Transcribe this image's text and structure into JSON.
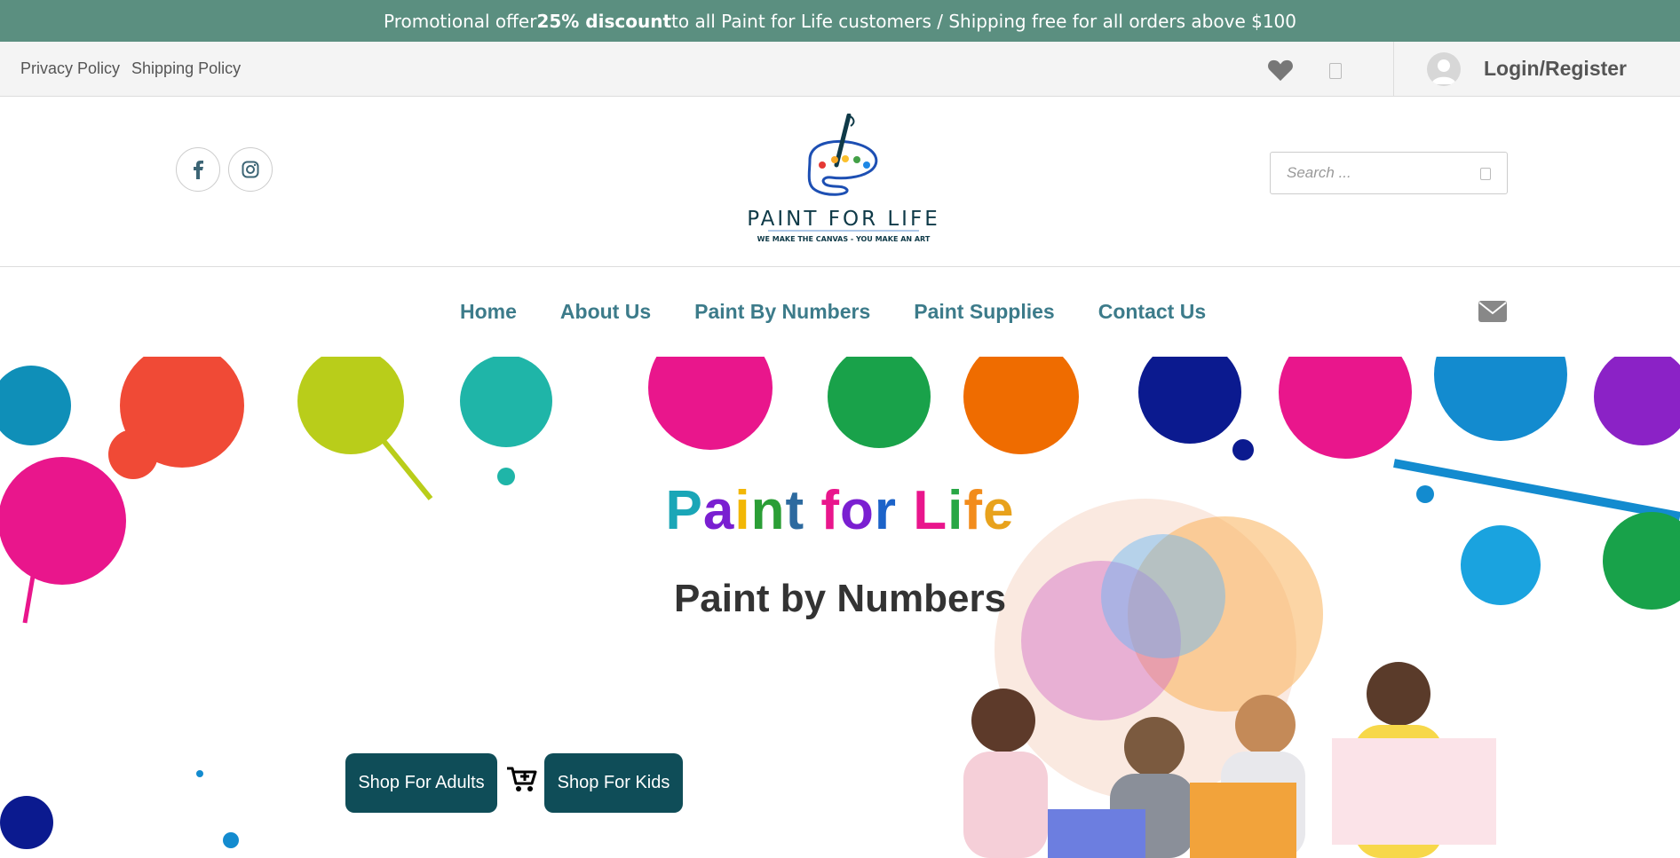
{
  "promo": {
    "prefix": "Promotional offer ",
    "highlight": "25% discount",
    "suffix": " to all Paint for Life customers / Shipping free for all orders above $100"
  },
  "topbar": {
    "links": [
      "Privacy Policy",
      "Shipping Policy"
    ],
    "login_label": "Login/Register"
  },
  "header": {
    "logo_name": "PAINT FOR LIFE",
    "logo_tagline": "WE MAKE THE CANVAS - YOU MAKE AN ART",
    "search_placeholder": "Search ..."
  },
  "nav": {
    "items": [
      "Home",
      "About Us",
      "Paint By Numbers",
      "Paint Supplies",
      "Contact Us"
    ]
  },
  "hero": {
    "title_letters": [
      "P",
      "a",
      "i",
      "n",
      "t",
      " ",
      "f",
      "o",
      "r",
      " ",
      "L",
      "i",
      "f",
      "e"
    ],
    "subtitle": "Paint by Numbers",
    "btn_adults": "Shop For Adults",
    "btn_kids": "Shop For Kids"
  },
  "icons": [
    "facebook-icon",
    "instagram-icon",
    "heart-icon",
    "cart-icon",
    "user-icon",
    "search-icon",
    "mail-icon",
    "add-to-cart-icon"
  ],
  "colors": {
    "promo_bg": "#5b8f80",
    "nav_text": "#3c7b8a",
    "button_bg": "#0f4d58",
    "title_letters": [
      "#1aa6b7",
      "#7a1fd1",
      "#f2b705",
      "#2b9e36",
      "#2d6a9f",
      "#ffffff",
      "#e9168c",
      "#7a1fd1",
      "#1c63c9",
      "#ffffff",
      "#e9168c",
      "#28a745",
      "#f28c1c",
      "#e8a21c"
    ]
  }
}
